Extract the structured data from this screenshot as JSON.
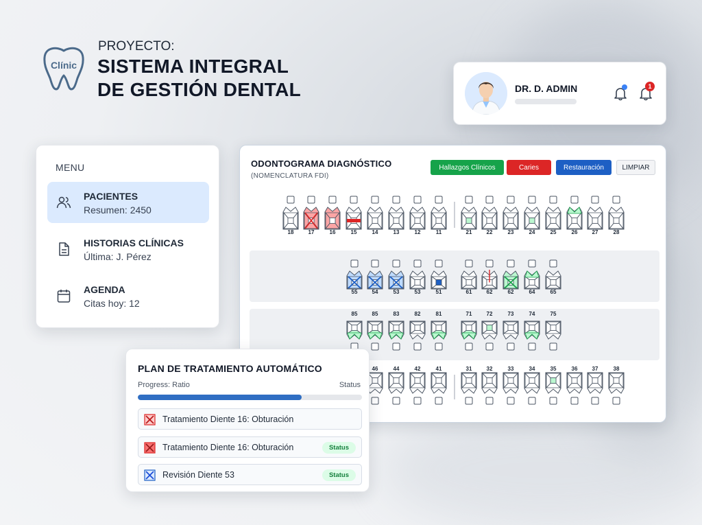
{
  "project": {
    "logo_text": "Clínic",
    "label": "PROYECTO:",
    "title_line1": "SISTEMA INTEGRAL",
    "title_line2": "DE GESTIÓN DENTAL"
  },
  "user": {
    "name": "DR. D. ADMIN",
    "notification_count": "1"
  },
  "menu": {
    "title": "MENU",
    "items": [
      {
        "title": "PACIENTES",
        "subtitle": "Resumen: 2450",
        "icon": "users-icon"
      },
      {
        "title": "HISTORIAS CLÍNICAS",
        "subtitle": "Última: J. Pérez",
        "icon": "document-icon"
      },
      {
        "title": "AGENDA",
        "subtitle": "Citas hoy: 12",
        "icon": "calendar-icon"
      }
    ]
  },
  "odontogram": {
    "title": "ODONTOGRAMA DIAGNÓSTICO",
    "subtitle": "(NOMENCLATURA FDI)",
    "buttons": {
      "findings": "Hallazgos Clínicos",
      "caries": "Caries",
      "restoration": "Restauración",
      "clear": "LIMPIAR"
    },
    "colors": {
      "green": "#16a34a",
      "red": "#dc2626",
      "blue": "#1d5fc4"
    },
    "rows": [
      {
        "teeth": [
          "18",
          "17",
          "16",
          "15",
          "14",
          "13",
          "12",
          "11",
          "21",
          "22",
          "23",
          "24",
          "25",
          "26",
          "27",
          "28"
        ],
        "states": [
          "none",
          "red-x",
          "red",
          "red-bar",
          "none",
          "none",
          "none",
          "none",
          "green-center",
          "none",
          "none",
          "green-center",
          "none",
          "green-top",
          "none",
          "none"
        ]
      },
      {
        "teeth": [
          "55",
          "54",
          "53",
          "53",
          "51",
          "61",
          "62",
          "62",
          "64",
          "65"
        ],
        "states": [
          "blue-x",
          "blue-x",
          "blue-x",
          "none",
          "blue-center",
          "none",
          "red-line",
          "green-x",
          "green-top",
          "none"
        ]
      },
      {
        "teeth": [
          "85",
          "85",
          "83",
          "82",
          "81",
          "71",
          "72",
          "73",
          "74",
          "75"
        ],
        "states": [
          "green-bottom",
          "green-bottom",
          "green-bottom",
          "none",
          "green-bottom",
          "green-bottom",
          "green-center",
          "none",
          "green-bottom",
          "none"
        ]
      },
      {
        "teeth": [
          "46",
          "44",
          "42",
          "41",
          "31",
          "32",
          "33",
          "34",
          "35",
          "36",
          "37",
          "38"
        ],
        "states": [
          "none",
          "none",
          "none",
          "none",
          "none",
          "none",
          "none",
          "none",
          "green-center",
          "none",
          "none",
          "none"
        ]
      }
    ]
  },
  "plan": {
    "title": "PLAN DE TRATAMIENTO AUTOMÁTICO",
    "progress_label": "Progress: Ratio",
    "status_label": "Status",
    "progress": 0.73,
    "tasks": [
      {
        "text": "Tratamiento Diente 16: Obturación",
        "badge": "",
        "icon": "red-x-tooth-icon"
      },
      {
        "text": "Tratamiento Diente 16: Obturación",
        "badge": "Status",
        "icon": "red-x-tooth-icon"
      },
      {
        "text": "Revisión Diente 53",
        "badge": "Status",
        "icon": "blue-x-tooth-icon"
      }
    ]
  }
}
